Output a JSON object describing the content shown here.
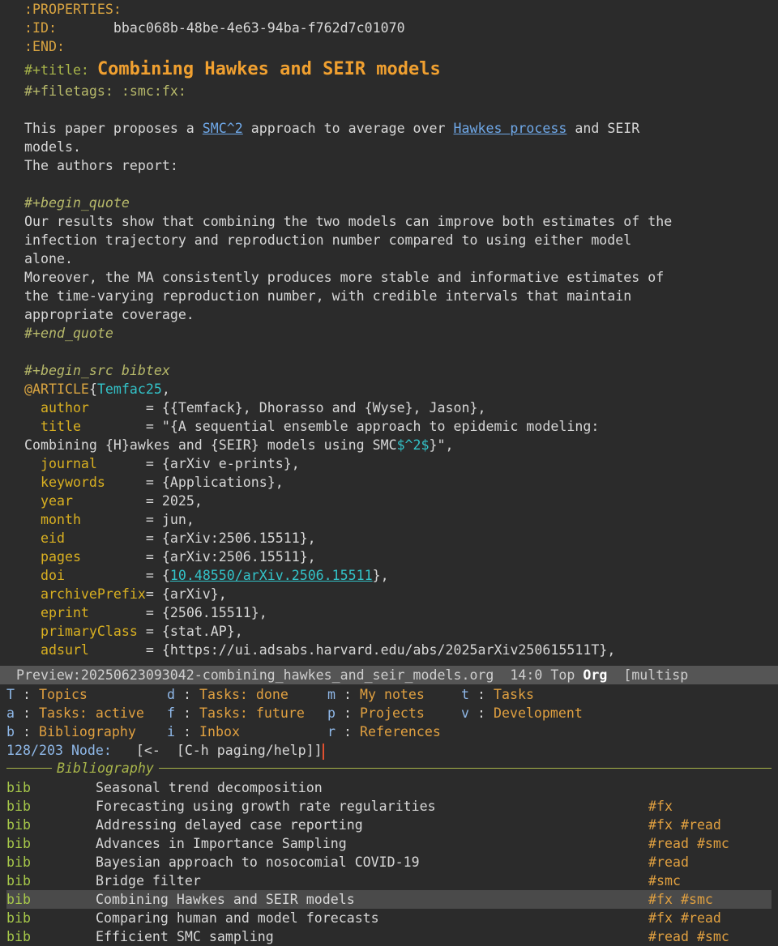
{
  "editor": {
    "properties_open": ":PROPERTIES:",
    "id_key": ":ID:",
    "id_value": "bbac068b-48be-4e63-94ba-f762d7c01070",
    "properties_end": ":END:",
    "title_key": "#+title:",
    "title_value": "Combining Hawkes and SEIR models",
    "filetags": "#+filetags: :smc:fx:",
    "para1_a": "This paper proposes a ",
    "para1_link1": "SMC^2",
    "para1_b": " approach to average over ",
    "para1_link2": "Hawkes process",
    "para1_c": " and SEIR",
    "para1_line2": "models.",
    "para1_line3": "The authors report:",
    "begin_quote": "#+begin_quote",
    "quote_lines": [
      "Our results show that combining the two models can improve both estimates of the",
      "infection trajectory and reproduction number compared to using either model",
      "alone.",
      "Moreover, the MA consistently produces more stable and informative estimates of",
      "the time-varying reproduction number, with credible intervals that maintain",
      "appropriate coverage."
    ],
    "end_quote": "#+end_quote",
    "begin_src": "#+begin_src bibtex",
    "article_type": "@ARTICLE",
    "article_brace": "{",
    "article_key": "Temfac25",
    "article_comma": ",",
    "bib_fields": [
      {
        "name": "author",
        "pad": "       ",
        "value": "= {{Temfack}, Dhorasso and {Wyse}, Jason},"
      },
      {
        "name": "title",
        "pad": "        ",
        "value": "= \"{A sequential ensemble approach to epidemic modeling:"
      }
    ],
    "title_cont_a": "Combining {H}awkes and {SEIR} models using SMC",
    "title_cont_math": "$^2$",
    "title_cont_b": "}\",",
    "bib_fields2": [
      {
        "name": "journal",
        "pad": "      ",
        "value": "= {arXiv e-prints},"
      },
      {
        "name": "keywords",
        "pad": "     ",
        "value": "= {Applications},"
      },
      {
        "name": "year",
        "pad": "         ",
        "value": "= 2025,"
      },
      {
        "name": "month",
        "pad": "        ",
        "value": "= jun,"
      },
      {
        "name": "eid",
        "pad": "          ",
        "value": "= {arXiv:2506.15511},"
      },
      {
        "name": "pages",
        "pad": "        ",
        "value": "= {arXiv:2506.15511},"
      }
    ],
    "doi_name": "doi",
    "doi_pad": "          ",
    "doi_pre": "= {",
    "doi_link": "10.48550/arXiv.2506.15511",
    "doi_post": "},",
    "bib_fields3": [
      {
        "name": "archivePrefix",
        "pad": "",
        "value": "= {arXiv},"
      },
      {
        "name": "eprint",
        "pad": "       ",
        "value": "= {2506.15511},"
      },
      {
        "name": "primaryClass",
        "pad": " ",
        "value": "= {stat.AP},"
      },
      {
        "name": "adsurl",
        "pad": "       ",
        "value": "= {https://ui.adsabs.harvard.edu/abs/2025arXiv250615511T},"
      }
    ]
  },
  "modeline": {
    "buffer": "Preview:20250623093042-combining_hawkes_and_seir_models.org",
    "position": "14:0",
    "scroll": "Top",
    "mode": "Org",
    "minor": "[multisp"
  },
  "menu": {
    "rows": [
      [
        {
          "key": "T",
          "label": "Topics"
        },
        {
          "key": "d",
          "label": "Tasks: done"
        },
        {
          "key": "m",
          "label": "My notes"
        },
        {
          "key": "t",
          "label": "Tasks"
        }
      ],
      [
        {
          "key": "a",
          "label": "Tasks: active"
        },
        {
          "key": "f",
          "label": "Tasks: future"
        },
        {
          "key": "p",
          "label": "Projects"
        },
        {
          "key": "v",
          "label": "Development"
        }
      ],
      [
        {
          "key": "b",
          "label": "Bibliography"
        },
        {
          "key": "i",
          "label": "Inbox"
        },
        {
          "key": "r",
          "label": "References"
        }
      ]
    ]
  },
  "minibuffer": {
    "count": "128/203",
    "prompt": "Node:",
    "hint": "  [<-  [C-h paging/help]]"
  },
  "completion": {
    "group": "Bibliography",
    "items": [
      {
        "type": "bib",
        "title": "Seasonal trend decomposition",
        "tags": ""
      },
      {
        "type": "bib",
        "title": "Forecasting using growth rate regularities",
        "tags": "#fx"
      },
      {
        "type": "bib",
        "title": "Addressing delayed case reporting",
        "tags": "#fx #read"
      },
      {
        "type": "bib",
        "title": "Advances in Importance Sampling",
        "tags": "#read #smc"
      },
      {
        "type": "bib",
        "title": "Bayesian approach to nosocomial COVID-19",
        "tags": "#read"
      },
      {
        "type": "bib",
        "title": "Bridge filter",
        "tags": "#smc"
      },
      {
        "type": "bib",
        "title": "Combining Hawkes and SEIR models",
        "tags": "#fx #smc",
        "selected": true
      },
      {
        "type": "bib",
        "title": "Comparing human and model forecasts",
        "tags": "#fx #read"
      },
      {
        "type": "bib",
        "title": "Efficient SMC sampling",
        "tags": "#read #smc"
      }
    ]
  }
}
